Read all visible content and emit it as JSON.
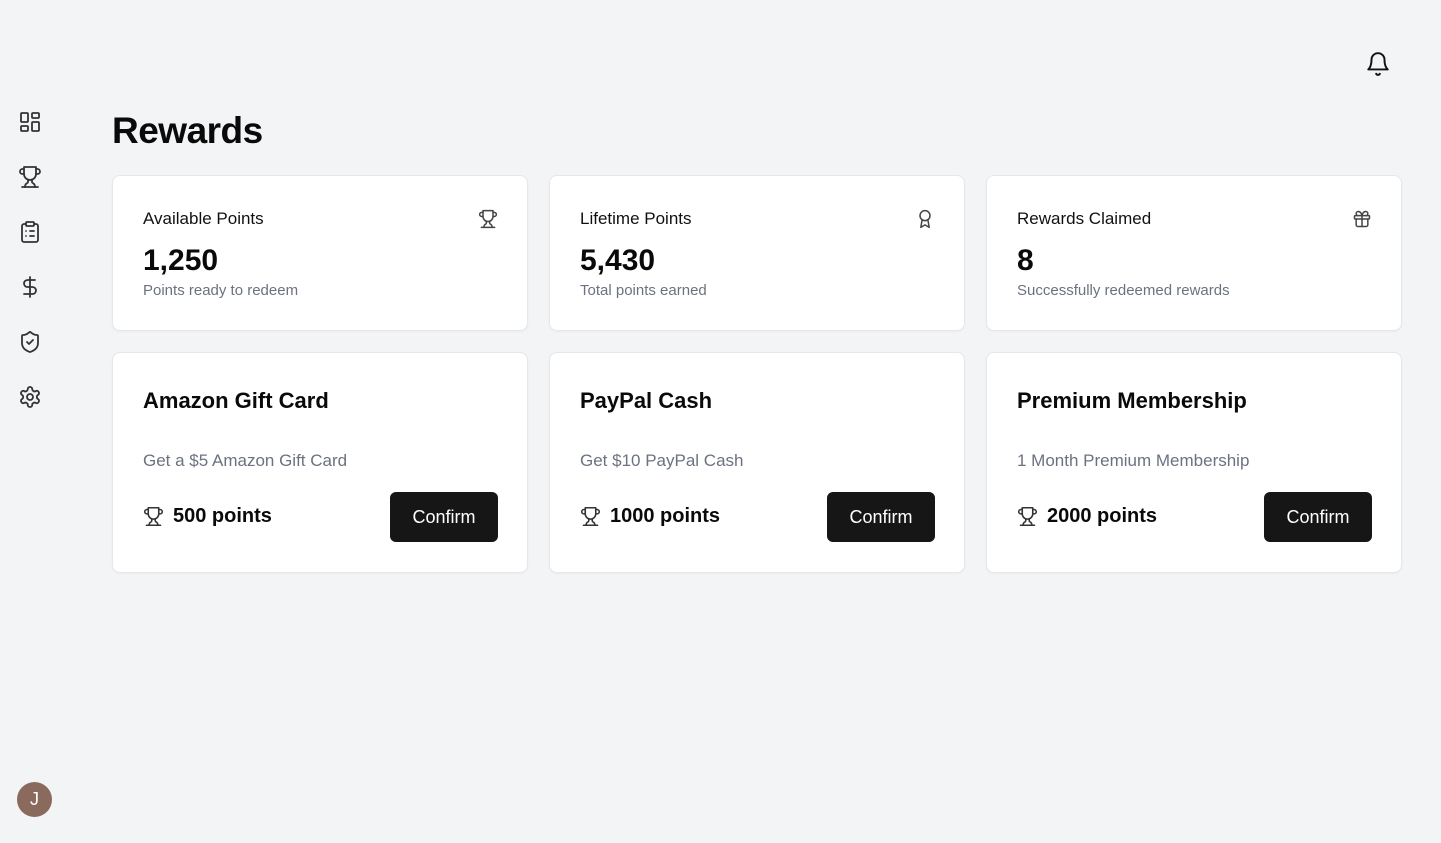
{
  "page": {
    "title": "Rewards"
  },
  "sidebar": {
    "items": [
      {
        "name": "dashboard",
        "icon": "dashboard-grid-icon"
      },
      {
        "name": "rewards",
        "icon": "trophy-icon"
      },
      {
        "name": "tasks",
        "icon": "clipboard-list-icon"
      },
      {
        "name": "earnings",
        "icon": "dollar-icon"
      },
      {
        "name": "security",
        "icon": "shield-check-icon"
      },
      {
        "name": "settings",
        "icon": "gear-icon"
      }
    ],
    "avatar_initial": "J",
    "avatar_color": "#8a6a5c"
  },
  "header": {
    "notification_icon": "bell-icon"
  },
  "stats": [
    {
      "label": "Available Points",
      "value": "1,250",
      "subtext": "Points ready to redeem",
      "icon": "trophy-icon"
    },
    {
      "label": "Lifetime Points",
      "value": "5,430",
      "subtext": "Total points earned",
      "icon": "award-icon"
    },
    {
      "label": "Rewards Claimed",
      "value": "8",
      "subtext": "Successfully redeemed rewards",
      "icon": "gift-icon"
    }
  ],
  "rewards": [
    {
      "title": "Amazon Gift Card",
      "description": "Get a $5 Amazon Gift Card",
      "cost": "500 points",
      "button": "Confirm"
    },
    {
      "title": "PayPal Cash",
      "description": "Get $10 PayPal Cash",
      "cost": "1000 points",
      "button": "Confirm"
    },
    {
      "title": "Premium Membership",
      "description": "1 Month Premium Membership",
      "cost": "2000 points",
      "button": "Confirm"
    }
  ],
  "colors": {
    "background": "#f3f4f6",
    "card": "#ffffff",
    "button": "#161616",
    "muted_text": "#6b7280"
  }
}
